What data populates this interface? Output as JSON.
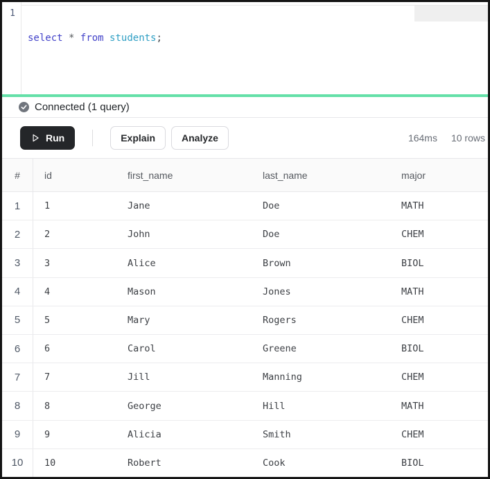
{
  "editor": {
    "line_number": "1",
    "code": "select * from students;",
    "tokens": [
      {
        "text": "select",
        "type": "keyword"
      },
      {
        "text": " ",
        "type": "plain"
      },
      {
        "text": "*",
        "type": "operator"
      },
      {
        "text": " ",
        "type": "plain"
      },
      {
        "text": "from",
        "type": "keyword"
      },
      {
        "text": " ",
        "type": "plain"
      },
      {
        "text": "students",
        "type": "entity"
      },
      {
        "text": ";",
        "type": "punctuation"
      }
    ]
  },
  "status": {
    "label": "Connected (1 query)",
    "icon": "check-circle-icon"
  },
  "toolbar": {
    "run_label": "Run",
    "run_icon": "play-icon",
    "explain_label": "Explain",
    "analyze_label": "Analyze",
    "duration": "164ms",
    "row_count": "10 rows"
  },
  "results_table": {
    "columns": [
      "#",
      "id",
      "first_name",
      "last_name",
      "major"
    ],
    "rows": [
      [
        "1",
        "1",
        "Jane",
        "Doe",
        "MATH"
      ],
      [
        "2",
        "2",
        "John",
        "Doe",
        "CHEM"
      ],
      [
        "3",
        "3",
        "Alice",
        "Brown",
        "BIOL"
      ],
      [
        "4",
        "4",
        "Mason",
        "Jones",
        "MATH"
      ],
      [
        "5",
        "5",
        "Mary",
        "Rogers",
        "CHEM"
      ],
      [
        "6",
        "6",
        "Carol",
        "Greene",
        "BIOL"
      ],
      [
        "7",
        "7",
        "Jill",
        "Manning",
        "CHEM"
      ],
      [
        "8",
        "8",
        "George",
        "Hill",
        "MATH"
      ],
      [
        "9",
        "9",
        "Alicia",
        "Smith",
        "CHEM"
      ],
      [
        "10",
        "10",
        "Robert",
        "Cook",
        "BIOL"
      ]
    ]
  },
  "colors": {
    "accent_green": "#64e0a8",
    "run_button_bg": "#242629",
    "syntax_keyword": "#4343c9",
    "syntax_operator": "#55585c",
    "syntax_entity": "#2f9fc4",
    "syntax_punctuation": "#3b3e42",
    "line_number": "#4d5a77",
    "status_icon": "#70757d"
  }
}
